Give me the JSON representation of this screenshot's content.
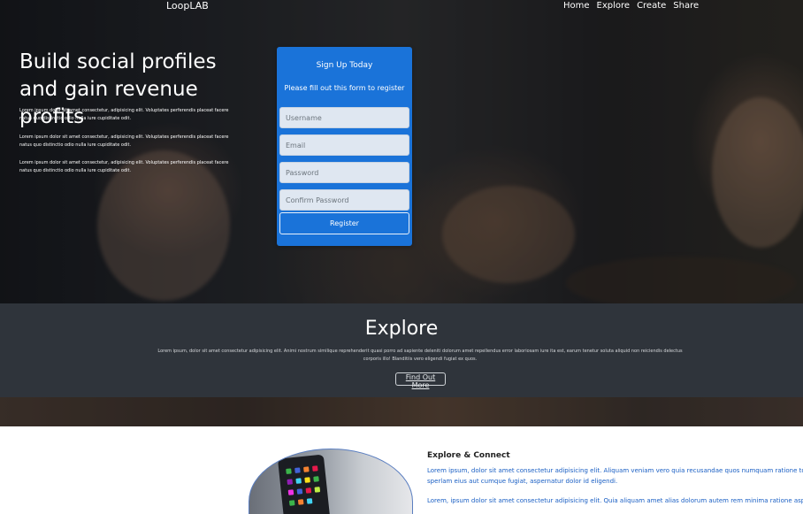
{
  "nav": {
    "brand": "LoopLAB",
    "links": [
      "Home",
      "Explore",
      "Create",
      "Share"
    ]
  },
  "hero": {
    "title": "Build social profiles and gain revenue profits",
    "paragraphs": [
      "Lorem ipsum dolor sit amet consectetur, adipisicing elit. Voluptates perferendis placeat facere natus quo distinctio odio nulla iure cupiditate odit.",
      "Lorem ipsum dolor sit amet consectetur, adipisicing elit. Voluptates perferendis placeat facere natus quo distinctio odio nulla iure cupiditate odit.",
      "Lorem ipsum dolor sit amet consectetur, adipisicing elit. Voluptates perferendis placeat facere natus quo distinctio odio nulla iure cupiditate odit."
    ]
  },
  "signup": {
    "title": "Sign Up Today",
    "subtitle": "Please fill out this form to register",
    "username_placeholder": "Username",
    "email_placeholder": "Email",
    "password_placeholder": "Password",
    "confirm_placeholder": "Confirm Password",
    "register_label": "Register"
  },
  "explore": {
    "title": "Explore",
    "text": "Lorem ipsum, dolor sit amet consectetur adipisicing elit. Animi nostrum similique reprehenderit quasi porro ad sapiente deleniti dolorum amet repellendus error laboriosam iure ita est, earum tenetur soluta aliquid non reiciendis delectus corporis illo! Blanditiis vero eligendi fugiat ex quos.",
    "button_label": "Find Out More"
  },
  "connect": {
    "title": "Explore & Connect",
    "text1": "Lorem ipsum, dolor sit amet consectetur adipisicing elit. Aliquam veniam vero quia recusandae quos numquam ratione totam rem, minima",
    "text1b": "sperlam eius aut cumque fugiat, aspernatur dolor id eligendi.",
    "text2": "Lorem, ipsum dolor sit amet consectetur adipisicing elit. Quia aliquam amet alias dolorum autem rem minima ratione aspernatur beatae vit"
  },
  "colors": {
    "signup_bg": "#1a73d9",
    "explore_bg": "#2f343b",
    "link_blue": "#1a5fc4"
  }
}
